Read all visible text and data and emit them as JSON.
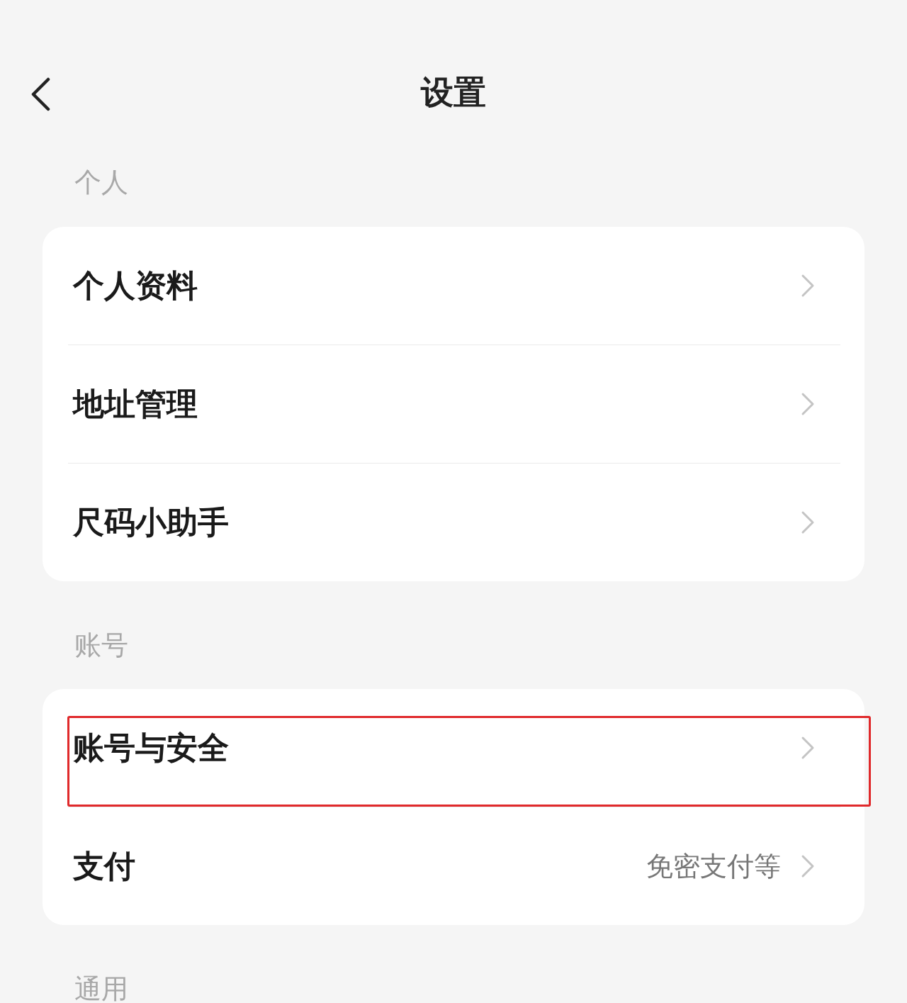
{
  "header": {
    "title": "设置"
  },
  "sections": [
    {
      "label": "个人",
      "items": [
        {
          "label": "个人资料",
          "highlighted": false
        },
        {
          "label": "地址管理",
          "highlighted": false
        },
        {
          "label": "尺码小助手",
          "highlighted": false
        }
      ]
    },
    {
      "label": "账号",
      "items": [
        {
          "label": "账号与安全",
          "highlighted": true
        },
        {
          "label": "支付",
          "value": "免密支付等",
          "highlighted": false
        }
      ]
    },
    {
      "label": "通用"
    }
  ]
}
